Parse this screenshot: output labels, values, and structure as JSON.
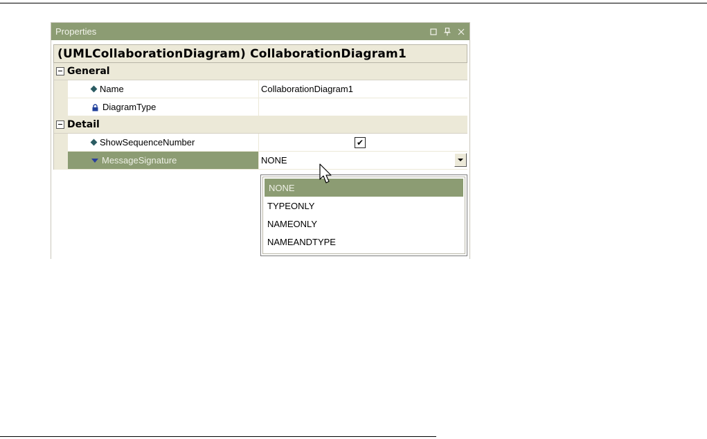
{
  "panel": {
    "title": "Properties",
    "buttons": [
      "restore-icon",
      "pin-icon",
      "close-icon"
    ],
    "header": "(UMLCollaborationDiagram) CollaborationDiagram1"
  },
  "categories": {
    "general": {
      "label": "General",
      "rows": [
        {
          "name": "Name",
          "value": "CollaborationDiagram1",
          "icon": "diamond-icon"
        },
        {
          "name": "DiagramType",
          "value": "",
          "icon": "lock-icon"
        }
      ]
    },
    "detail": {
      "label": "Detail",
      "rows": [
        {
          "name": "ShowSequenceNumber",
          "value": "checked",
          "icon": "diamond-icon"
        },
        {
          "name": "MessageSignature",
          "value": "NONE",
          "icon": "triangle-down-icon"
        }
      ]
    }
  },
  "dropdown": {
    "selected": "NONE",
    "options": [
      "NONE",
      "TYPEONLY",
      "NAMEONLY",
      "NAMEANDTYPE"
    ]
  },
  "colors": {
    "accent": "#8c9c73",
    "header_bg": "#ece9d8"
  }
}
